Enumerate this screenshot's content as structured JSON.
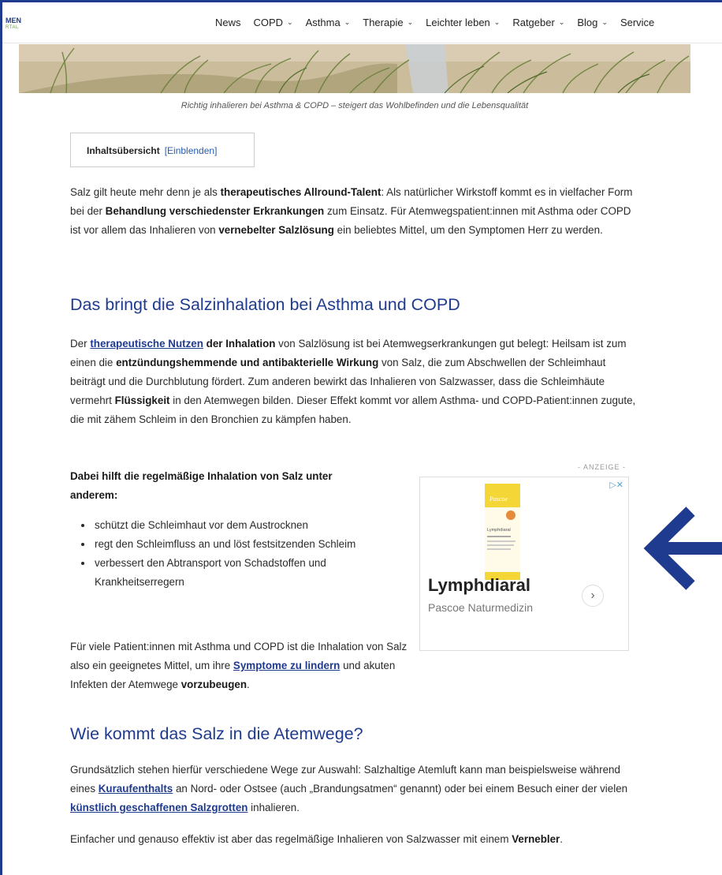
{
  "header": {
    "logo_line1": "MEN",
    "logo_line2": "RTAL",
    "nav": [
      {
        "label": "News",
        "has_dropdown": false
      },
      {
        "label": "COPD",
        "has_dropdown": true
      },
      {
        "label": "Asthma",
        "has_dropdown": true
      },
      {
        "label": "Therapie",
        "has_dropdown": true
      },
      {
        "label": "Leichter leben",
        "has_dropdown": true
      },
      {
        "label": "Ratgeber",
        "has_dropdown": true
      },
      {
        "label": "Blog",
        "has_dropdown": true
      },
      {
        "label": "Service",
        "has_dropdown": false
      }
    ]
  },
  "hero": {
    "caption": "Richtig inhalieren bei Asthma & COPD – steigert das Wohlbefinden und die Lebensqualität"
  },
  "toc": {
    "title": "Inhaltsübersicht",
    "toggle": "[Einblenden]"
  },
  "intro": {
    "p1_a": "Salz gilt heute mehr denn je als ",
    "p1_b": "therapeutisches Allround-Talent",
    "p1_c": ": Als natürlicher Wirkstoff kommt es in vielfacher Form bei der ",
    "p1_d": "Behandlung verschiedenster Erkrankungen",
    "p1_e": " zum Einsatz. Für Atemwegspatient:innen mit Asthma oder COPD ist vor allem das Inhalieren von ",
    "p1_f": "vernebelter Salzlösung",
    "p1_g": " ein beliebtes Mittel, um den Symptomen Herr zu werden."
  },
  "section1": {
    "heading": "Das bringt die Salzinhalation bei Asthma und COPD",
    "p_a": "Der ",
    "p_link": "therapeutische Nutzen",
    "p_b": " der Inhalation",
    "p_c": " von Salzlösung ist bei Atemwegserkrankungen gut belegt: Heilsam ist zum einen die ",
    "p_d": "entzündungshemmende und antibakterielle Wirkung",
    "p_e": " von Salz, die zum Abschwellen der Schleimhaut beiträgt und die Durchblutung fördert. Zum anderen bewirkt das Inhalieren von Salzwasser, dass die Schleimhäute vermehrt ",
    "p_f": "Flüssigkeit",
    "p_g": " in den Atemwegen bilden. Dieser Effekt kommt vor allem Asthma- und COPD-Patient:innen zugute, die mit zähem Schleim in den Bronchien zu kämpfen haben.",
    "list_intro": "Dabei hilft die regelmäßige Inhalation von Salz unter anderem:",
    "bullets": [
      "schützt die Schleimhaut vor dem Austrocknen",
      "regt den Schleimfluss an und löst festsitzenden Schleim",
      "verbessert den Abtransport von Schadstoffen und Krankheitserregern"
    ],
    "p2_a": "Für viele Patient:innen mit Asthma und COPD ist die Inhalation von Salz also ein geeignetes Mittel, um ihre ",
    "p2_link": "Symptome zu lindern",
    "p2_b": " und akuten Infekten der Atemwege ",
    "p2_c": "vorzubeugen",
    "p2_d": "."
  },
  "ad": {
    "label": "- ANZEIGE -",
    "pack_brand": "Pascoe",
    "pack_name": "Lymphdiaral",
    "title": "Lymphdiaral",
    "subtitle": "Pascoe Naturmedizin",
    "next": "›"
  },
  "section2": {
    "heading": "Wie kommt das Salz in die Atemwege?",
    "p_a": "Grundsätzlich stehen hierfür verschiedene Wege zur Auswahl: Salzhaltige Atemluft kann man beispielsweise während eines ",
    "p_link1": "Kuraufenthalts",
    "p_b": " an Nord- oder Ostsee (auch „Brandungsatmen“ genannt) oder bei einem Besuch einer der vielen ",
    "p_link2": "künstlich geschaffenen Salzgrotten",
    "p_c": " inhalieren.",
    "p2_a": "Einfacher und genauso effektiv ist aber das regelmäßige Inhalieren von Salzwasser mit einem ",
    "p2_b": "Vernebler",
    "p2_c": "."
  },
  "colors": {
    "accent": "#1f3b8f",
    "link": "#1f3b8f",
    "text": "#2a2a2a"
  }
}
